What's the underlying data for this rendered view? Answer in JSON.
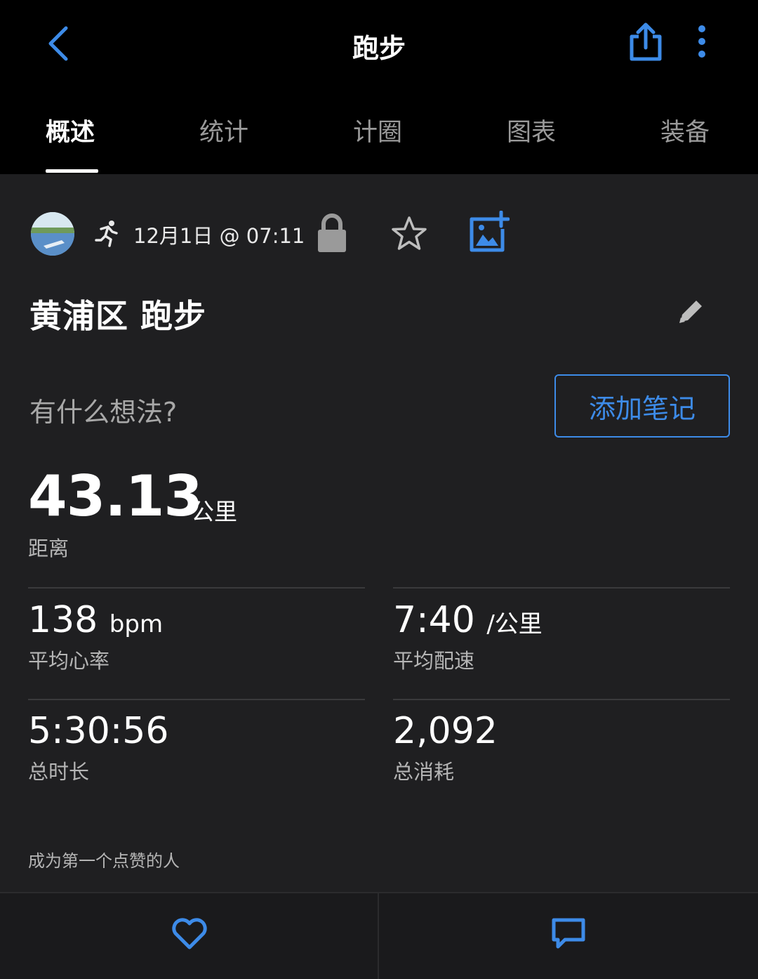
{
  "header": {
    "title": "跑步"
  },
  "tabs": [
    {
      "label": "概述",
      "active": true
    },
    {
      "label": "统计",
      "active": false
    },
    {
      "label": "计圈",
      "active": false
    },
    {
      "label": "图表",
      "active": false
    },
    {
      "label": "装备",
      "active": false
    }
  ],
  "activity": {
    "datetime": "12月1日 @ 07:11",
    "title": "黄浦区 跑步",
    "thoughts_placeholder": "有什么想法?",
    "add_note_label": "添加笔记"
  },
  "distance": {
    "value": "43.13",
    "unit": "公里",
    "label": "距离"
  },
  "stats": [
    {
      "value": "138",
      "unit": "bpm",
      "label": "平均心率"
    },
    {
      "value": "7:40",
      "unit": "/公里",
      "label": "平均配速"
    },
    {
      "value": "5:30:56",
      "unit": "",
      "label": "总时长"
    },
    {
      "value": "2,092",
      "unit": "",
      "label": "总消耗"
    }
  ],
  "social": {
    "like_prompt": "成为第一个点赞的人"
  },
  "colors": {
    "accent": "#3d8be8",
    "background": "#1f1f21",
    "header_background": "#000000"
  },
  "icons": {
    "back": "chevron-left-icon",
    "share": "share-icon",
    "more": "more-vertical-icon",
    "runner": "running-icon",
    "lock": "lock-icon",
    "star": "star-icon",
    "add_photo": "add-photo-icon",
    "edit": "pencil-icon",
    "like": "heart-icon",
    "comment": "comment-icon"
  }
}
